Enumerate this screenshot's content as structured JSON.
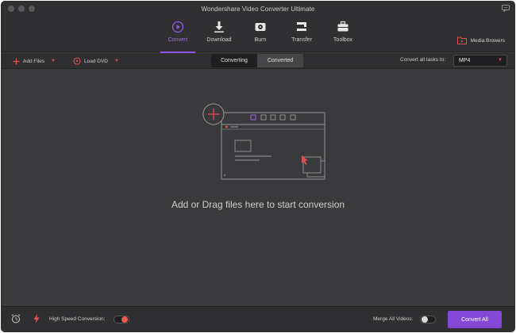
{
  "window": {
    "title": "Wondershare Video Converter Ultimate"
  },
  "nav": {
    "items": [
      {
        "label": "Convert",
        "icon": "convert-icon",
        "active": true
      },
      {
        "label": "Download",
        "icon": "download-icon"
      },
      {
        "label": "Burn",
        "icon": "burn-icon"
      },
      {
        "label": "Transfer",
        "icon": "transfer-icon"
      },
      {
        "label": "Toolbox",
        "icon": "toolbox-icon"
      }
    ],
    "media_browser": "Media Browers"
  },
  "toolbar": {
    "add_files": "Add Files",
    "load_dvd": "Load DVD",
    "tabs": [
      "Converting",
      "Converted"
    ],
    "convert_all_tasks_to": "Convert all tasks to:",
    "format": "MP4"
  },
  "main": {
    "drop_text": "Add or Drag files here to start conversion"
  },
  "footer": {
    "high_speed_label": "High Speed Conversion:",
    "high_speed_on": true,
    "merge_label": "Merge All Videos:",
    "merge_on": false,
    "convert_all": "Convert All"
  },
  "colors": {
    "accent": "#8349d6",
    "red": "#e05252",
    "bg": "#3a3a3c"
  }
}
